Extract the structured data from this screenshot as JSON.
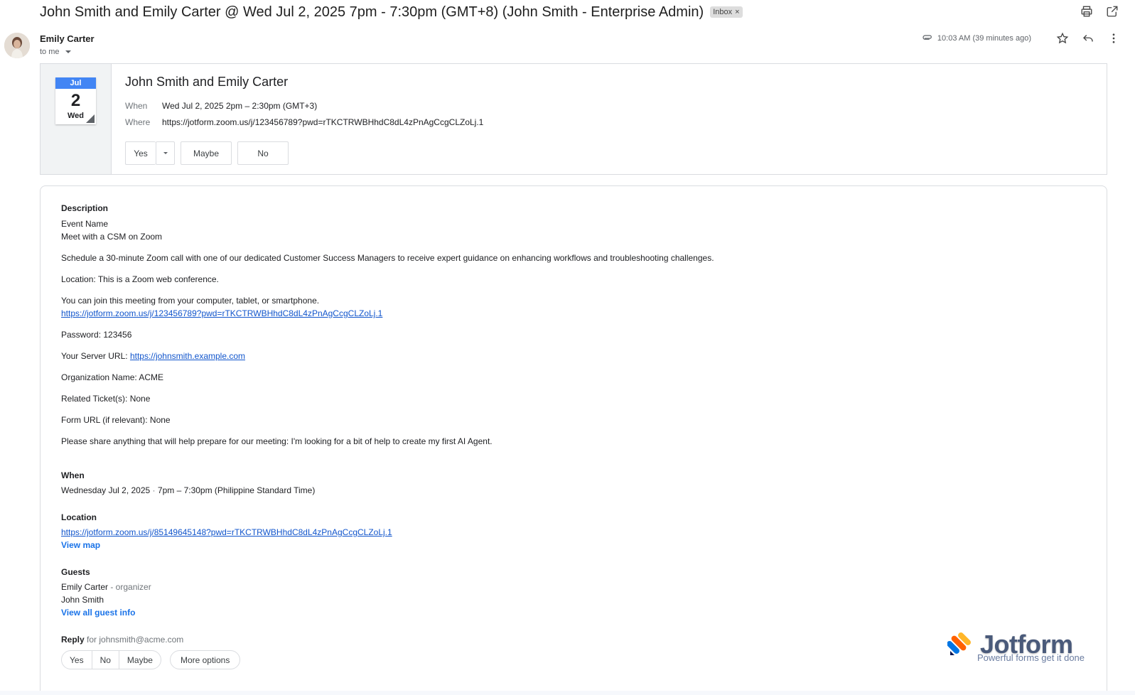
{
  "subject": "John Smith and Emily Carter @ Wed Jul 2, 2025 7pm - 7:30pm (GMT+8) (John Smith - Enterprise Admin)",
  "label_chip": "Inbox",
  "label_chip_close": "×",
  "sender": {
    "name": "Emily Carter",
    "to": "to me",
    "timestamp": "10:03 AM (39 minutes ago)"
  },
  "invite": {
    "month": "Jul",
    "day": "2",
    "weekday": "Wed",
    "title": "John Smith and Emily Carter",
    "when_label": "When",
    "when_value": "Wed Jul 2, 2025 2pm – 2:30pm (GMT+3)",
    "where_label": "Where",
    "where_value": "https://jotform.zoom.us/j/123456789?pwd=rTKCTRWBHhdC8dL4zPnAgCcgCLZoLj.1",
    "rsvp": {
      "yes": "Yes",
      "maybe": "Maybe",
      "no": "No"
    }
  },
  "details": {
    "description_heading": "Description",
    "event_name_label": "Event Name",
    "event_name": "Meet with a CSM on Zoom",
    "schedule_text": "Schedule a 30-minute Zoom call with one of our dedicated Customer Success Managers to receive expert guidance on enhancing workflows and troubleshooting challenges.",
    "location_text": "Location: This is a Zoom web conference.",
    "join_text": "You can join this meeting from your computer, tablet, or smartphone.",
    "join_link": "https://jotform.zoom.us/j/123456789?pwd=rTKCTRWBHhdC8dL4zPnAgCcgCLZoLj.1",
    "password": "Password: 123456",
    "server_url_label": "Your Server URL: ",
    "server_url": "https://johnsmith.example.com",
    "org_name": "Organization Name: ACME",
    "tickets": "Related Ticket(s): None",
    "form_url": "Form URL (if relevant): None",
    "share_text": "Please share anything that will help prepare for our meeting: I'm looking for a bit of help to create my first AI Agent.",
    "when_heading": "When",
    "when_date": "Wednesday Jul 2, 2025",
    "when_sep": "·",
    "when_time": "7pm – 7:30pm (Philippine Standard Time)",
    "location_heading": "Location",
    "location_link": "https://jotform.zoom.us/j/85149645148?pwd=rTKCTRWBHhdC8dL4zPnAgCcgCLZoLj.1",
    "view_map": "View map",
    "guests_heading": "Guests",
    "guest_1": "Emily Carter",
    "guest_1_role": " - organizer",
    "guest_2": "John Smith",
    "view_all_guests": "View all guest info",
    "reply_label": "Reply",
    "reply_for": " for johnsmith@acme.com",
    "reply_yes": "Yes",
    "reply_no": "No",
    "reply_maybe": "Maybe",
    "more_options": "More options"
  },
  "watermark": {
    "brand": "Jotform",
    "tagline": "Powerful forms get it done"
  },
  "colors": {
    "calendar_header": "#4285f4",
    "link": "#1155cc",
    "action_link": "#1a73e8"
  }
}
